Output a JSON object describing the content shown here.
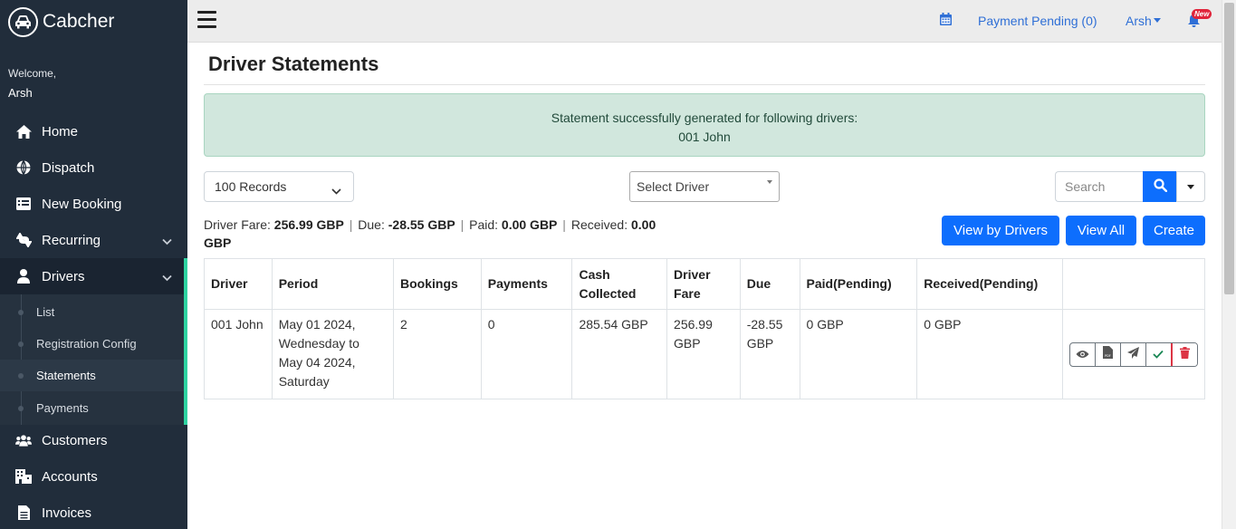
{
  "app": {
    "name": "Cabcher",
    "welcome": "Welcome,",
    "user": "Arsh"
  },
  "sidebar": {
    "items": [
      {
        "label": "Home",
        "icon": "home-icon"
      },
      {
        "label": "Dispatch",
        "icon": "globe-icon"
      },
      {
        "label": "New Booking",
        "icon": "list-icon"
      },
      {
        "label": "Recurring",
        "icon": "repeat-icon"
      },
      {
        "label": "Drivers",
        "icon": "user-icon"
      },
      {
        "label": "Customers",
        "icon": "users-icon"
      },
      {
        "label": "Accounts",
        "icon": "building-icon"
      },
      {
        "label": "Invoices",
        "icon": "file-icon"
      }
    ],
    "drivers_sub": [
      "List",
      "Registration Config",
      "Statements",
      "Payments"
    ]
  },
  "topbar": {
    "payment_pending": "Payment Pending (0)",
    "user": "Arsh",
    "badge": "New"
  },
  "page": {
    "title": "Driver Statements"
  },
  "alert": {
    "line1": "Statement successfully generated for following drivers:",
    "line2": "001 John"
  },
  "filters": {
    "records": "100 Records",
    "driver": "Select Driver",
    "search_placeholder": "Search"
  },
  "summary": {
    "fare_label": "Driver Fare:",
    "fare": "256.99 GBP",
    "due_label": "Due:",
    "due": "-28.55 GBP",
    "paid_label": "Paid:",
    "paid": "0.00 GBP",
    "received_label": "Received:",
    "received": "0.00",
    "received_unit": "GBP"
  },
  "buttons": {
    "view_by_drivers": "View by Drivers",
    "view_all": "View All",
    "create": "Create"
  },
  "table": {
    "headers": [
      "Driver",
      "Period",
      "Bookings",
      "Payments",
      "Cash Collected",
      "Driver Fare",
      "Due",
      "Paid(Pending)",
      "Received(Pending)",
      ""
    ],
    "rows": [
      {
        "driver": "001 John",
        "period": "May 01 2024, Wednesday to May 04 2024, Saturday",
        "bookings": "2",
        "payments": "0",
        "cash": "285.54 GBP",
        "fare": "256.99 GBP",
        "due": "-28.55 GBP",
        "paid": "0 GBP",
        "received": "0 GBP"
      }
    ]
  },
  "colors": {
    "sidebar": "#212d3b",
    "accent": "#2ed3a1",
    "primary": "#0d6efd",
    "alert_bg": "#d1e7dd"
  }
}
